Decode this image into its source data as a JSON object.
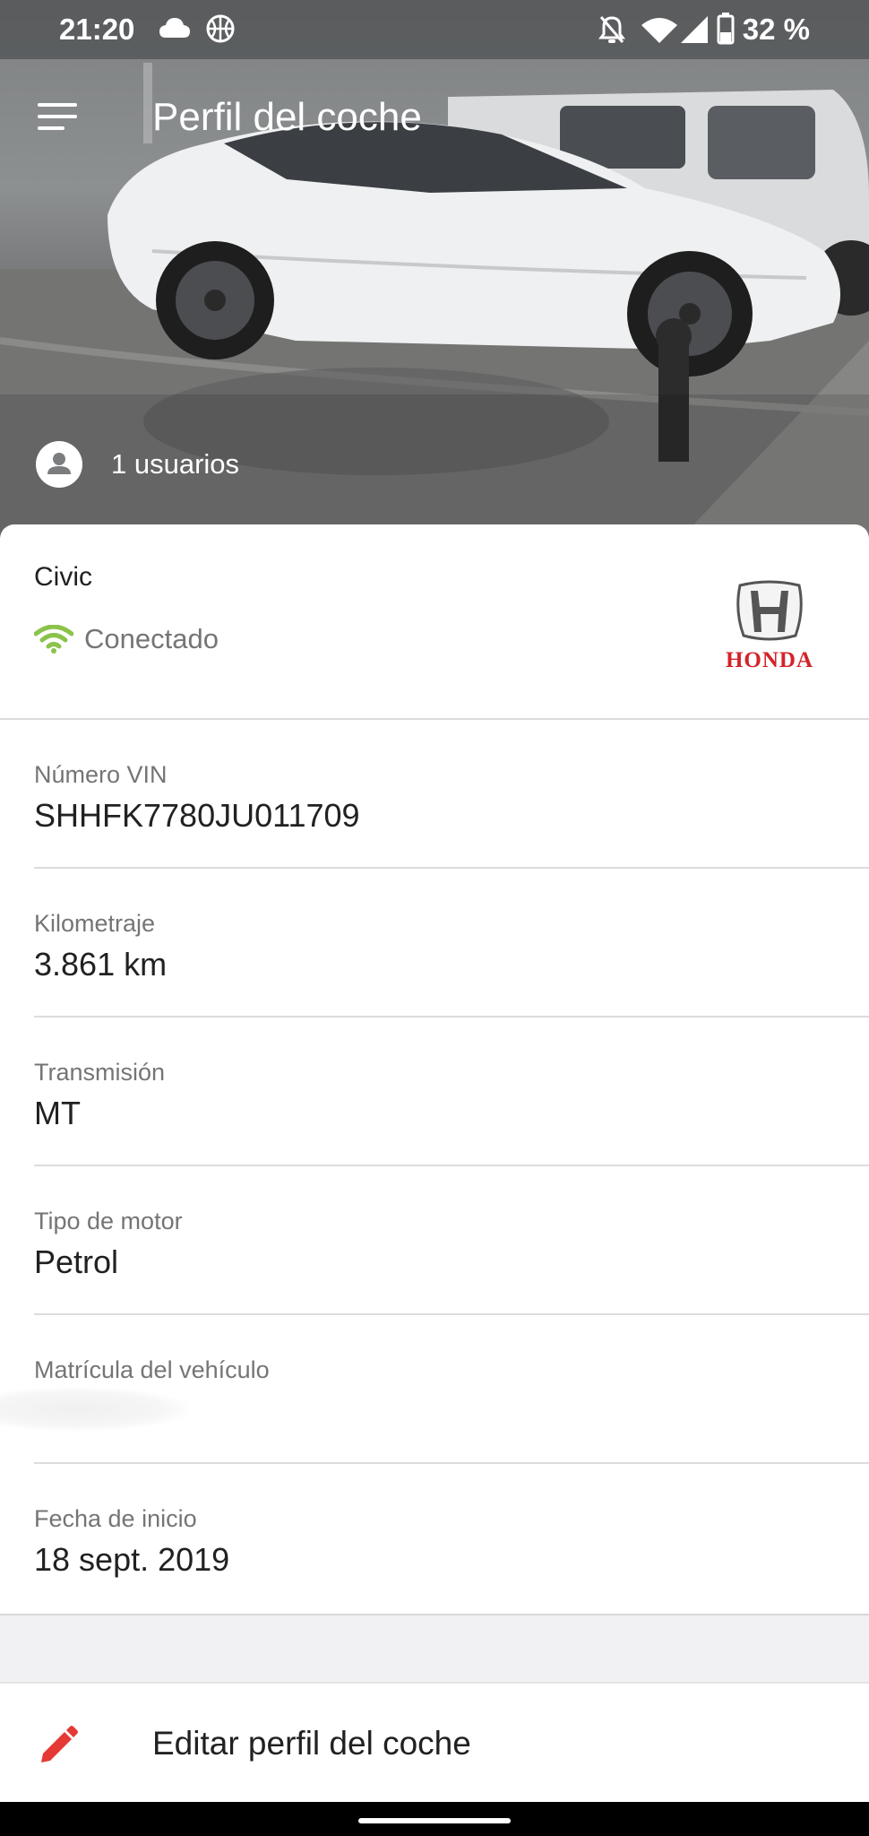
{
  "status_bar": {
    "time": "21:20",
    "battery_percent": "32 %",
    "icons": [
      "cloud-icon",
      "basketball-icon",
      "notifications-off-icon",
      "wifi-icon",
      "cellular-signal-icon",
      "battery-icon"
    ]
  },
  "header": {
    "title": "Perfil del coche",
    "menu_icon": "menu-icon"
  },
  "users": {
    "label": "1 usuarios",
    "icon": "account-circle-icon"
  },
  "car": {
    "model": "Civic",
    "connection_status": "Conectado",
    "connection_color": "#8bc34a",
    "brand": "HONDA",
    "brand_color": "#d3232a"
  },
  "fields": [
    {
      "label": "Número VIN",
      "value": "SHHFK7780JU011709"
    },
    {
      "label": "Kilometraje",
      "value": "3.861 km"
    },
    {
      "label": "Transmisión",
      "value": "MT"
    },
    {
      "label": "Tipo de motor",
      "value": "Petrol"
    },
    {
      "label": "Matrícula del vehículo",
      "value": ""
    },
    {
      "label": "Fecha de inicio",
      "value": "18 sept. 2019"
    }
  ],
  "actions": {
    "edit_label": "Editar perfil del coche",
    "edit_icon": "pencil-icon",
    "edit_icon_color": "#e53935"
  }
}
